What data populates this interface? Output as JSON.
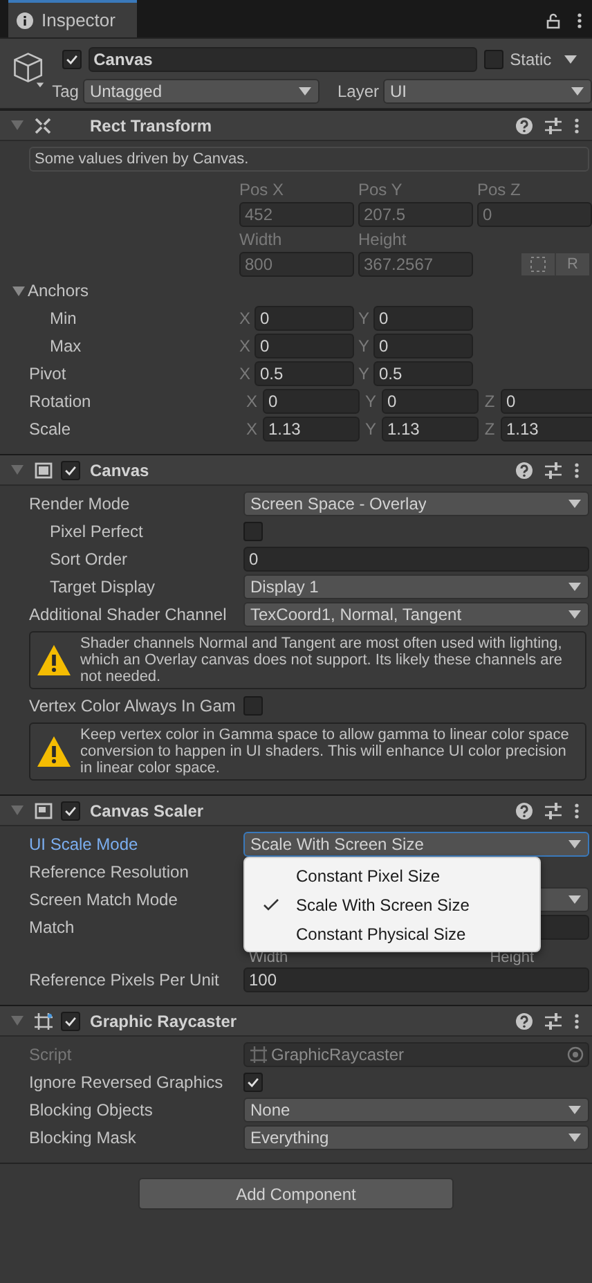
{
  "tab": {
    "title": "Inspector"
  },
  "object": {
    "active": true,
    "name": "Canvas",
    "static": false,
    "static_label": "Static",
    "tag_label": "Tag",
    "tag": "Untagged",
    "layer_label": "Layer",
    "layer": "UI"
  },
  "components": [
    {
      "kind": "rect_transform",
      "title": "Rect Transform",
      "expanded": true,
      "rows": [
        {
          "kind": "info",
          "text": "Some values driven by Canvas."
        },
        {
          "kind": "labels",
          "disabled": true,
          "labels": [
            "Pos X",
            "Pos Y",
            "Pos Z"
          ]
        },
        {
          "kind": "values",
          "disabled": true,
          "values": [
            "452",
            "207.5",
            "0"
          ]
        },
        {
          "kind": "labels",
          "disabled": true,
          "labels": [
            "Width",
            "Height"
          ]
        },
        {
          "kind": "values",
          "disabled": true,
          "values": [
            "800",
            "367.2567"
          ],
          "raw_button": "R"
        },
        {
          "kind": "foldout",
          "label": "Anchors",
          "expanded": true,
          "children": [
            {
              "kind": "vector",
              "label": "Min",
              "axes": [
                {
                  "axis": "X",
                  "value": "0"
                },
                {
                  "axis": "Y",
                  "value": "0"
                }
              ]
            },
            {
              "kind": "vector",
              "label": "Max",
              "axes": [
                {
                  "axis": "X",
                  "value": "0"
                },
                {
                  "axis": "Y",
                  "value": "0"
                }
              ]
            }
          ]
        },
        {
          "kind": "vector",
          "label": "Pivot",
          "axes": [
            {
              "axis": "X",
              "value": "0.5"
            },
            {
              "axis": "Y",
              "value": "0.5"
            }
          ]
        },
        {
          "kind": "vector",
          "label": "Rotation",
          "axes": [
            {
              "axis": "X",
              "value": "0"
            },
            {
              "axis": "Y",
              "value": "0"
            },
            {
              "axis": "Z",
              "value": "0"
            }
          ]
        },
        {
          "kind": "vector",
          "label": "Scale",
          "axes": [
            {
              "axis": "X",
              "value": "1.13"
            },
            {
              "axis": "Y",
              "value": "1.13"
            },
            {
              "axis": "Z",
              "value": "1.13"
            }
          ]
        }
      ]
    },
    {
      "kind": "canvas",
      "title": "Canvas",
      "enabled": true,
      "expanded": true,
      "rows": [
        {
          "kind": "dropdown",
          "label": "Render Mode",
          "value": "Screen Space - Overlay",
          "focused": false,
          "children": [
            {
              "kind": "checkbox",
              "label": "Pixel Perfect",
              "checked": false
            },
            {
              "kind": "field",
              "label": "Sort Order",
              "value": "0"
            },
            {
              "kind": "dropdown",
              "label": "Target Display",
              "value": "Display 1",
              "focused": false
            }
          ]
        },
        {
          "kind": "dropdown",
          "label": "Additional Shader Channel",
          "value": "TexCoord1, Normal, Tangent",
          "focused": false
        },
        {
          "kind": "warning",
          "text": "Shader channels Normal and Tangent are most often used with lighting, which an Overlay canvas does not support. Its likely these channels are not needed."
        },
        {
          "kind": "checkbox",
          "label": "Vertex Color Always In Gam",
          "checked": false
        },
        {
          "kind": "warning",
          "text": "Keep vertex color in Gamma space to allow gamma to linear color space conversion to happen in UI shaders. This will enhance UI color precision in linear color space."
        }
      ]
    },
    {
      "kind": "scaler",
      "title": "Canvas Scaler",
      "enabled": true,
      "expanded": true,
      "rows": [
        {
          "kind": "dropdown",
          "label": "UI Scale Mode",
          "value": "Scale With Screen Size",
          "focused": true,
          "popup": [
            {
              "label": "Constant Pixel Size",
              "selected": false
            },
            {
              "label": "Scale With Screen Size",
              "selected": true
            },
            {
              "label": "Constant Physical Size",
              "selected": false
            }
          ]
        },
        {
          "kind": "label_only",
          "label": "Reference Resolution"
        },
        {
          "kind": "dropdown",
          "label": "Screen Match Mode",
          "focused": false
        },
        {
          "kind": "slider",
          "label": "Match",
          "min_label": "Width",
          "max_label": "Height"
        },
        {
          "kind": "field",
          "label": "Reference Pixels Per Unit",
          "value": "100"
        }
      ]
    },
    {
      "kind": "raycaster",
      "title": "Graphic Raycaster",
      "enabled": true,
      "expanded": true,
      "rows": [
        {
          "kind": "object",
          "label": "Script",
          "value": "GraphicRaycaster",
          "disabled": true
        },
        {
          "kind": "checkbox",
          "label": "Ignore Reversed Graphics",
          "checked": true
        },
        {
          "kind": "dropdown",
          "label": "Blocking Objects",
          "value": "None",
          "focused": false
        },
        {
          "kind": "dropdown",
          "label": "Blocking Mask",
          "value": "Everything",
          "focused": false
        }
      ]
    }
  ],
  "add_component": "Add Component"
}
